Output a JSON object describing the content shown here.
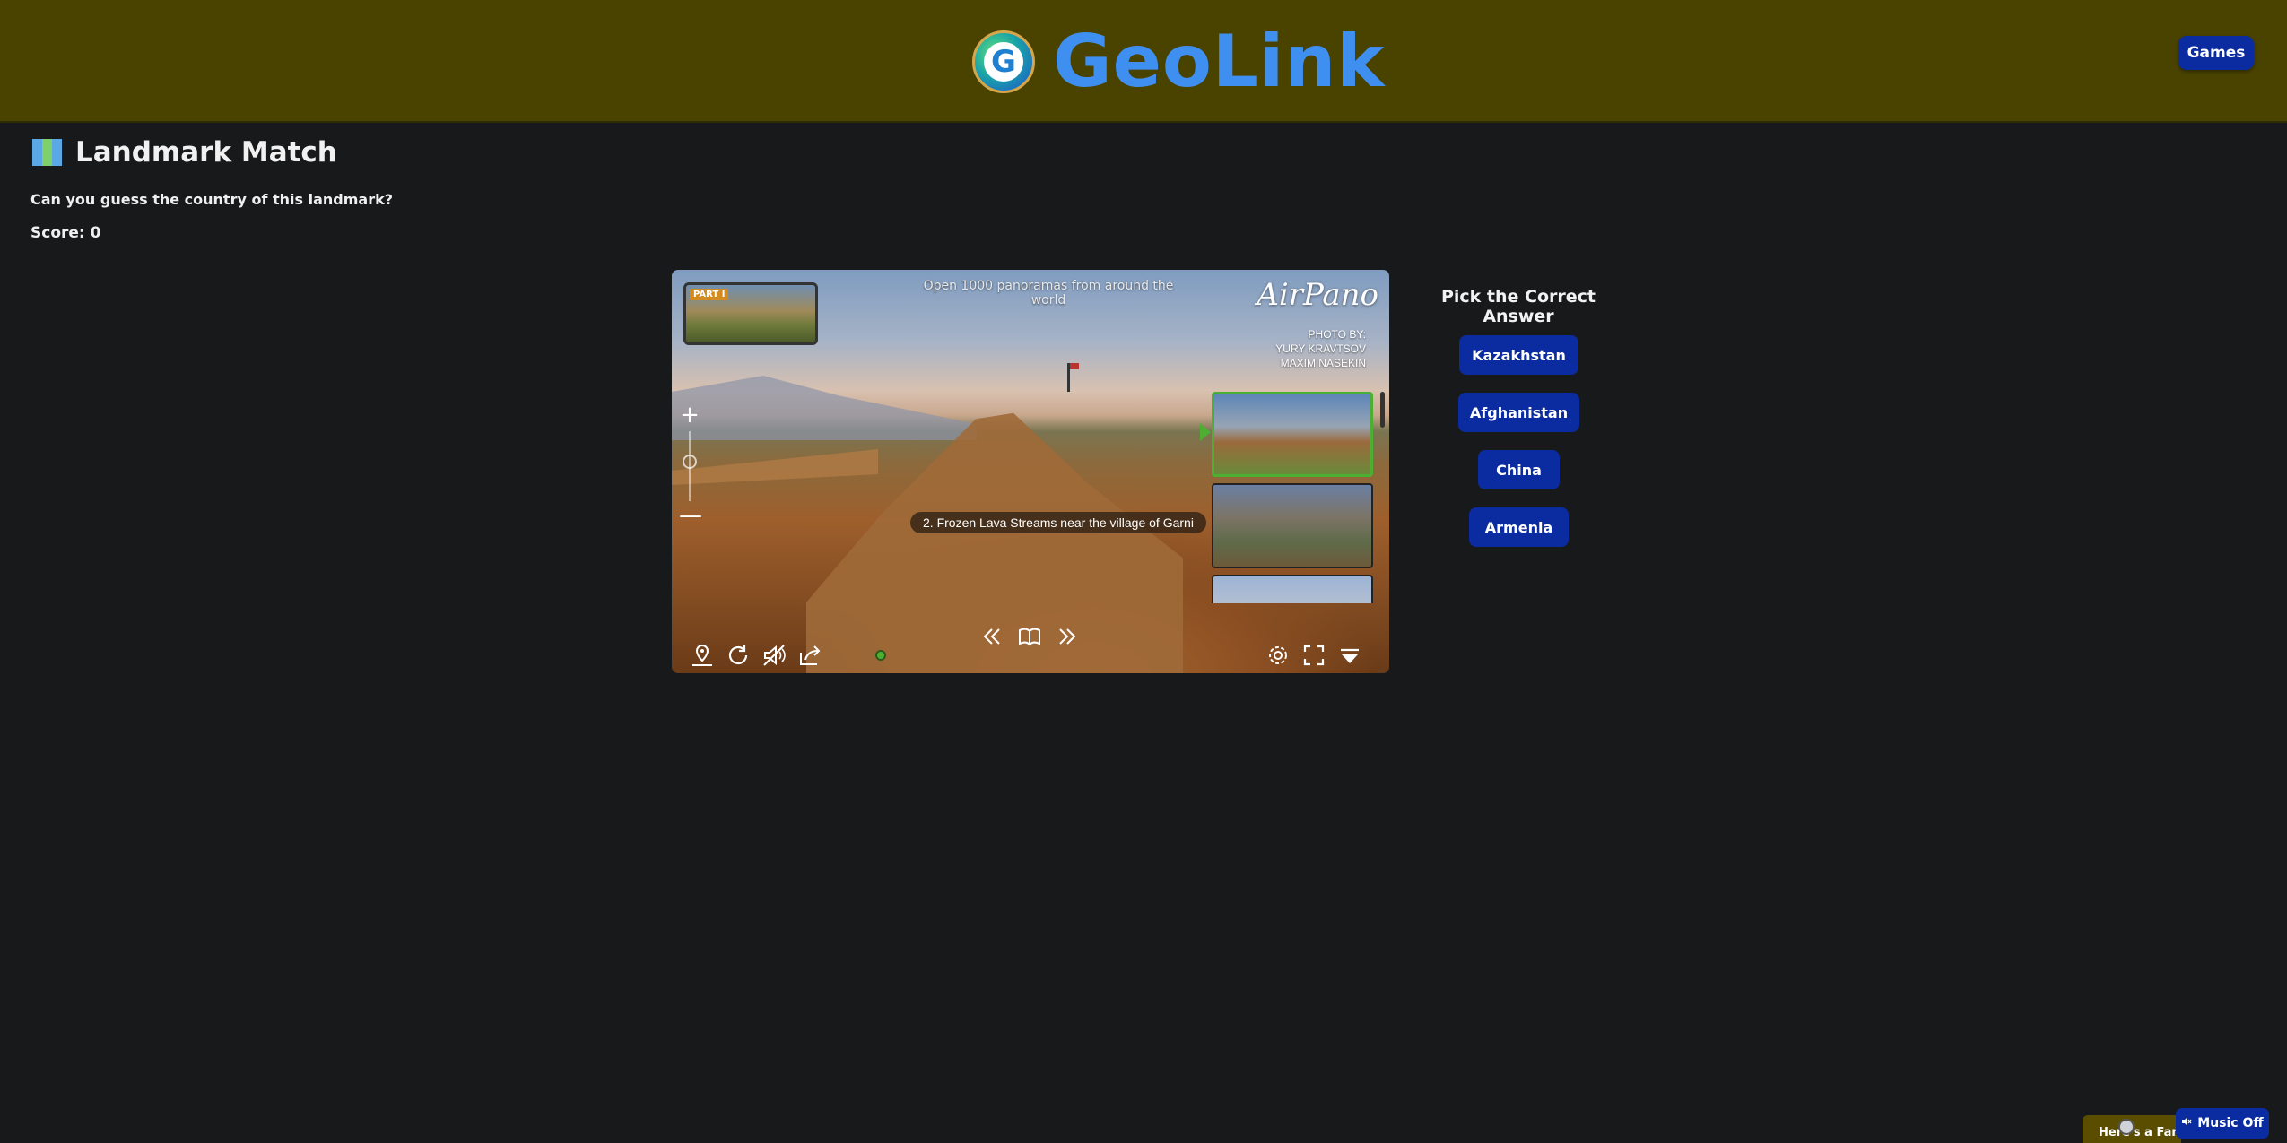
{
  "header": {
    "logo_letter": "G",
    "brand_name": "GeoLink",
    "games_label": "Games"
  },
  "page": {
    "title": "Landmark Match",
    "subtitle": "Can you guess the country of this landmark?",
    "score": "Score: 0"
  },
  "viewer": {
    "part_tag": "PART I",
    "tagline": "Open 1000 panoramas from around the world",
    "brand": "AirPano",
    "photo_by": [
      "PHOTO BY:",
      "YURY KRAVTSOV",
      "MAXIM NASEKIN"
    ],
    "caption": "2. Frozen Lava Streams near the village of Garni",
    "zoom_in": "+",
    "zoom_out": "—"
  },
  "answers": {
    "title": "Pick the Correct Answer",
    "options": [
      "Kazakhstan",
      "Afghanistan",
      "China",
      "Armenia"
    ]
  },
  "footer": {
    "mini_player_text": "Here's a Famo",
    "music_label": "Music Off"
  },
  "colors": {
    "header_bg": "#4a4300",
    "button_bg": "#0a2ca0",
    "page_bg": "#18191b",
    "brand_text": "#3f8ff0"
  }
}
